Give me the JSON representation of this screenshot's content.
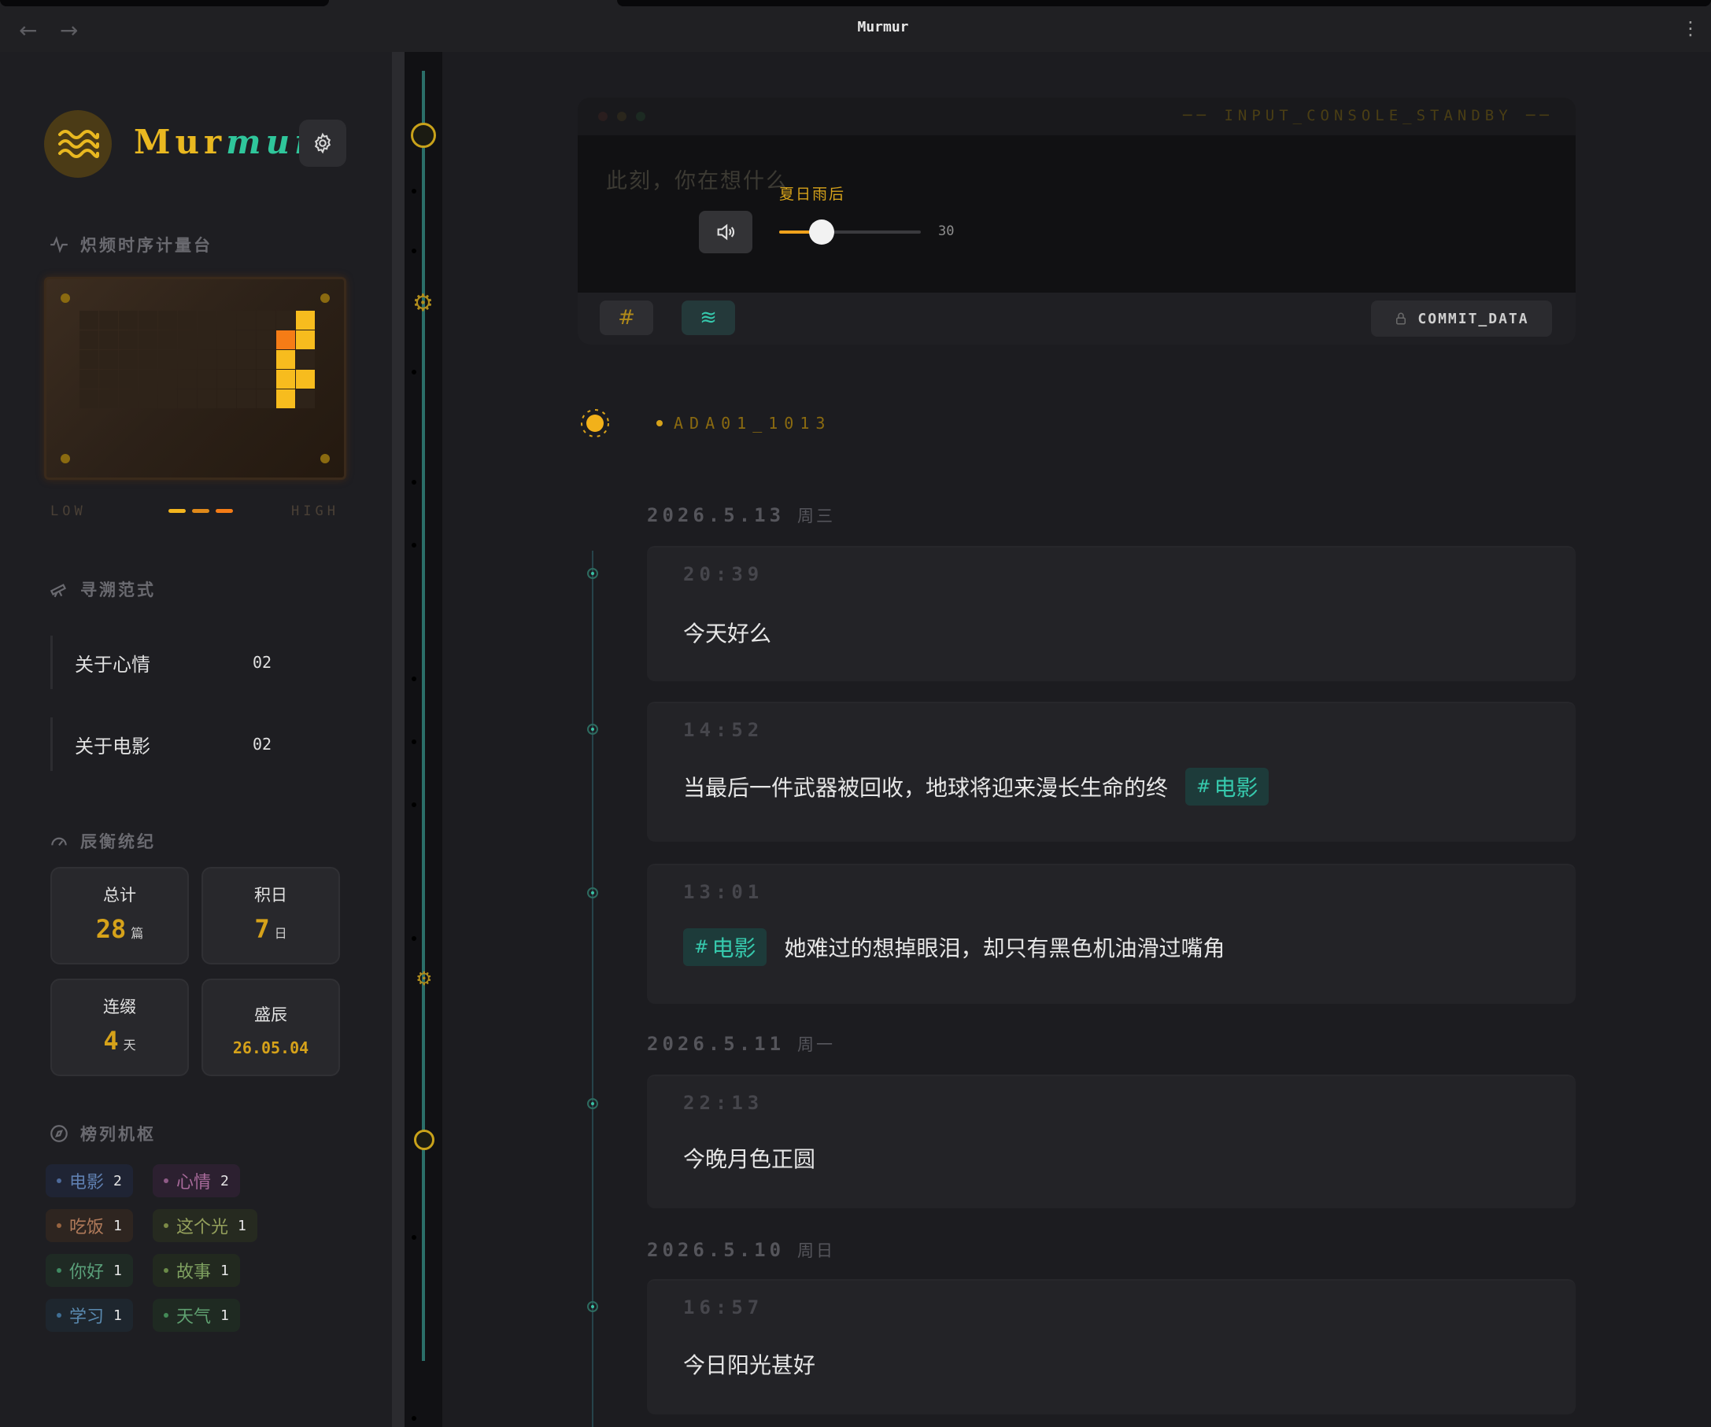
{
  "window": {
    "title": "Murmur",
    "back_icon": "←",
    "forward_icon": "→",
    "menu_icon": "⋮"
  },
  "brand": {
    "name_a": "Mur",
    "name_b": "mur"
  },
  "sections": {
    "heatmap": "炽频时序计量台",
    "explore": "寻溯范式",
    "stats": "辰衡统纪",
    "tags": "榜列机枢"
  },
  "heatmap": {
    "low": "LOW",
    "high": "HIGH",
    "active_cells": [
      {
        "row": 0,
        "col": 11,
        "level": "high"
      },
      {
        "row": 1,
        "col": 10,
        "level": "max"
      },
      {
        "row": 1,
        "col": 11,
        "level": "high"
      },
      {
        "row": 2,
        "col": 10,
        "level": "high"
      },
      {
        "row": 3,
        "col": 10,
        "level": "high"
      },
      {
        "row": 3,
        "col": 11,
        "level": "high"
      },
      {
        "row": 4,
        "col": 10,
        "level": "high"
      }
    ],
    "colors": {
      "high": "#f7bc1e",
      "max": "#f57c16",
      "empty": "#2e2319"
    }
  },
  "explore": [
    {
      "label": "关于心情",
      "count": "02"
    },
    {
      "label": "关于电影",
      "count": "02"
    }
  ],
  "stats": {
    "total": {
      "label": "总计",
      "value": "28",
      "unit": "篇"
    },
    "days": {
      "label": "积日",
      "value": "7",
      "unit": "日"
    },
    "streak": {
      "label": "连缀",
      "value": "4",
      "unit": "天"
    },
    "peak": {
      "label": "盛辰",
      "value": "26.05.04"
    }
  },
  "tags": [
    {
      "name": "电影",
      "count": "1"
    },
    {
      "name": "心情",
      "count": "2"
    },
    {
      "name": "吃饭",
      "count": "1"
    },
    {
      "name": "这个光",
      "count": "1"
    },
    {
      "name": "你好",
      "count": "1"
    },
    {
      "name": "故事",
      "count": "1"
    },
    {
      "name": "学习",
      "count": "1"
    },
    {
      "name": "天气",
      "count": "1"
    }
  ],
  "console": {
    "status": "INPUT_CONSOLE_STANDBY",
    "placeholder": "此刻，你在想什么",
    "music_title": "夏日雨后",
    "volume": 30,
    "volume_label": "30",
    "hash_icon": "#",
    "wave_icon": "≋",
    "commit": "COMMIT_DATA"
  },
  "node": {
    "id": "ADA01_1013"
  },
  "entries": {
    "d1": {
      "date": "2026.5.13",
      "weekday": "周三"
    },
    "e1": {
      "time": "20:39",
      "text": "今天好么"
    },
    "e2": {
      "time": "14:52",
      "text": "当最后一件武器被回收，地球将迎来漫长生命的终",
      "tag": "电影"
    },
    "e3": {
      "time": "13:01",
      "tag": "电影",
      "text": "她难过的想掉眼泪，却只有黑色机油滑过嘴角"
    },
    "d2": {
      "date": "2026.5.11",
      "weekday": "周一"
    },
    "e4": {
      "time": "22:13",
      "text": "今晚月色正圆"
    },
    "d3": {
      "date": "2026.5.10",
      "weekday": "周日"
    },
    "e5": {
      "time": "16:57",
      "text": "今日阳光甚好"
    }
  }
}
